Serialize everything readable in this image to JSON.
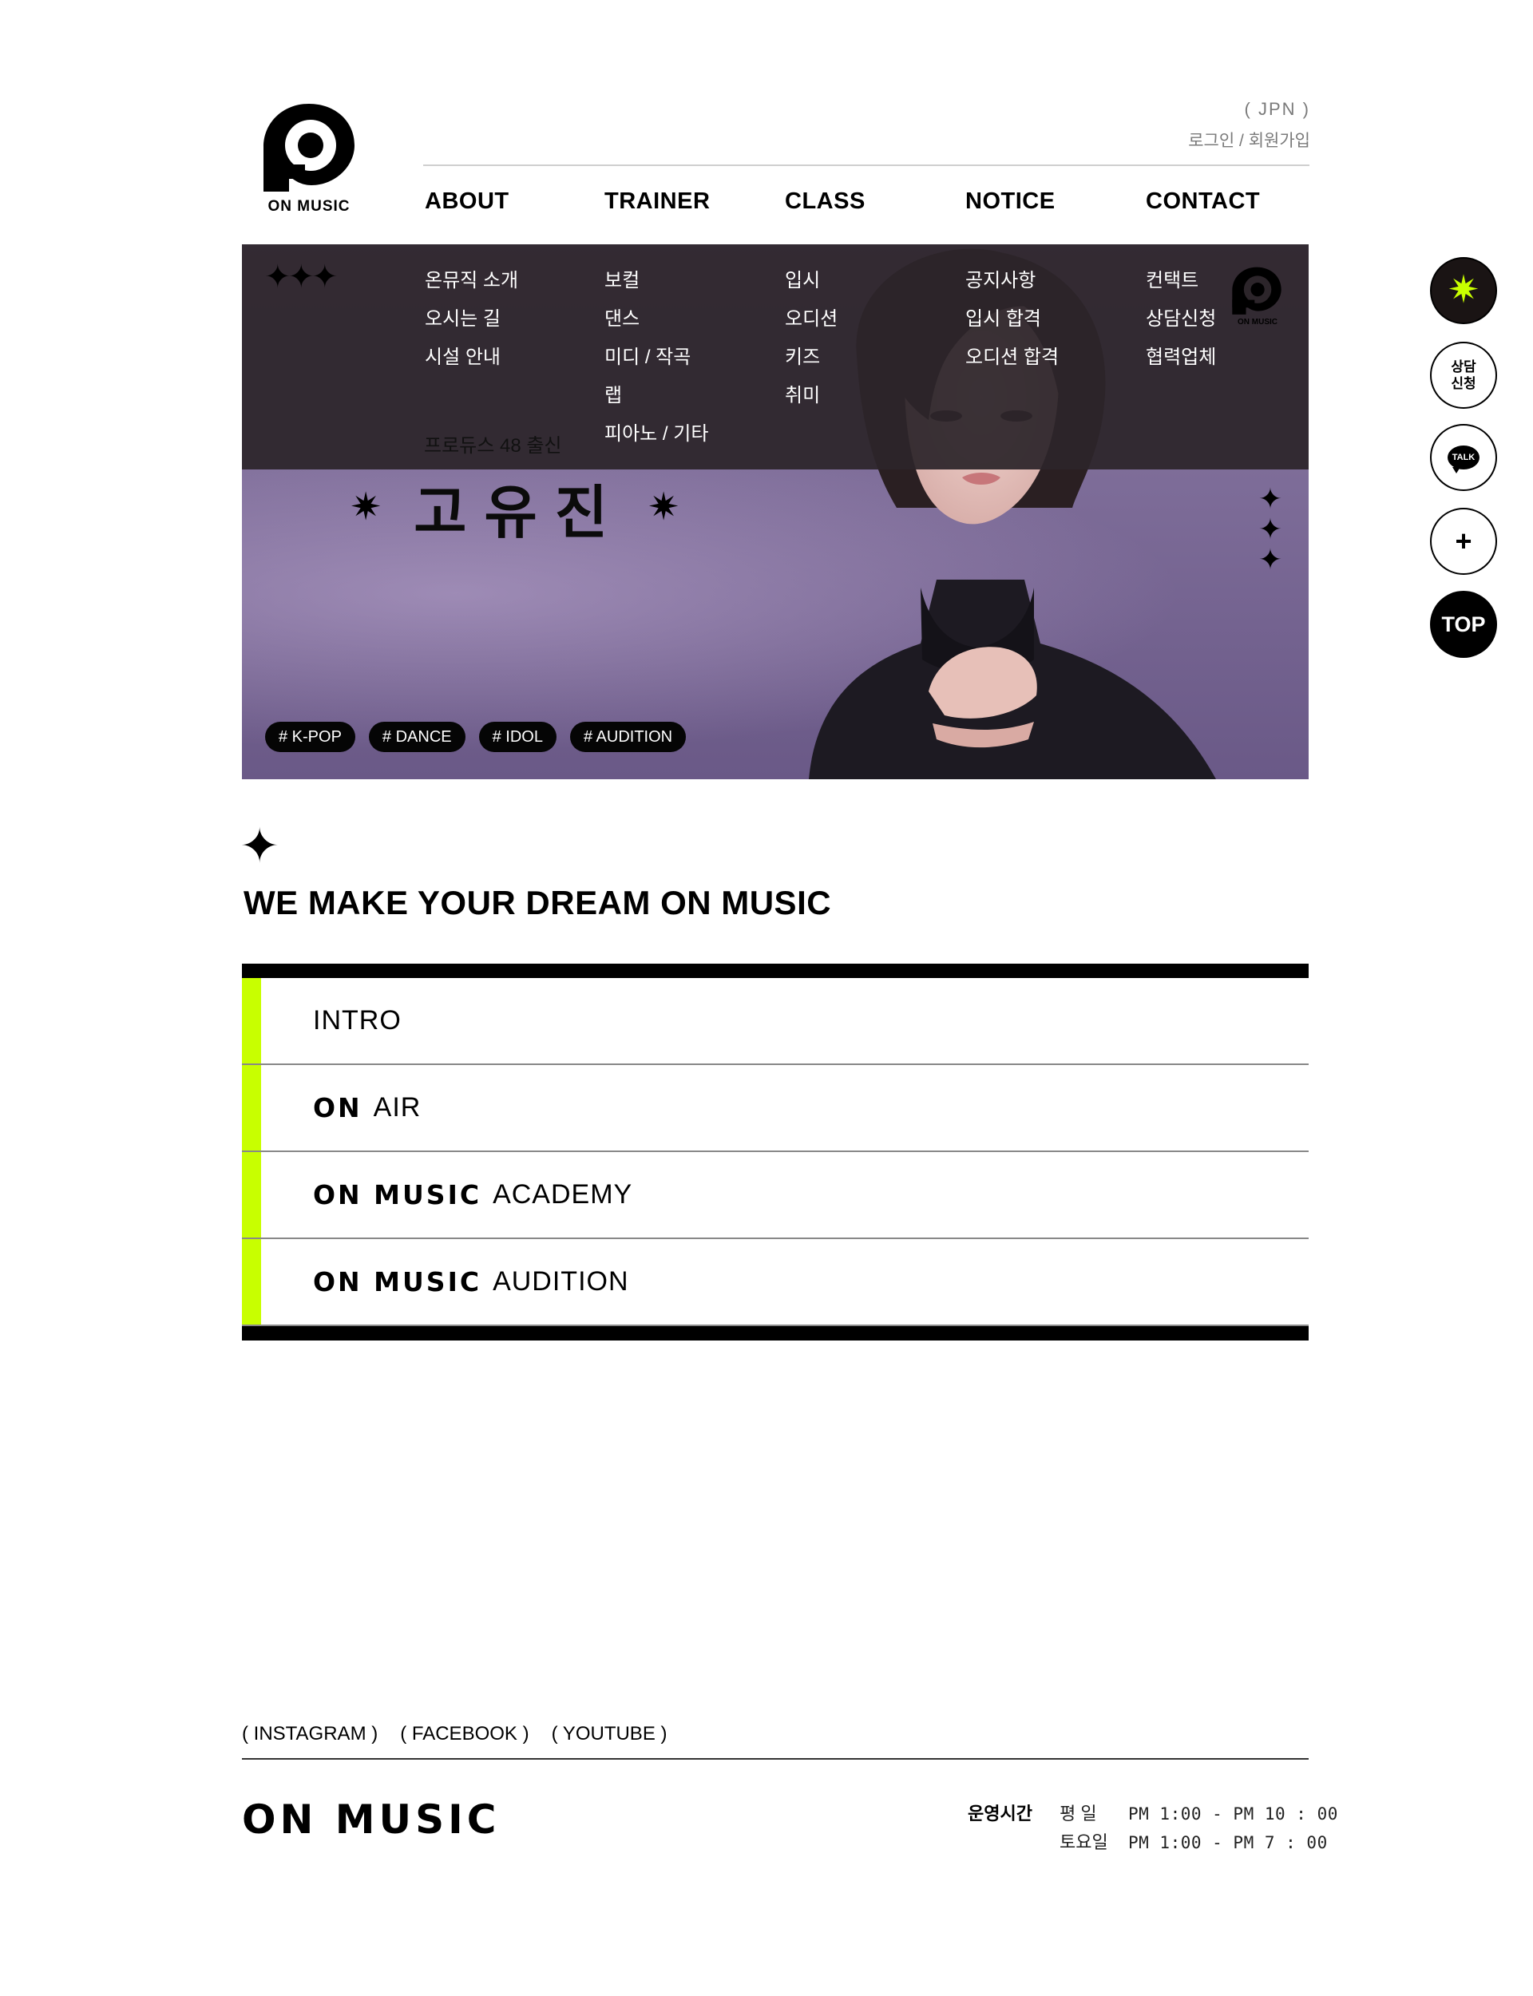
{
  "brand": {
    "logo_text": "ON MUSIC",
    "accent_color": "#c8ff00"
  },
  "header": {
    "lang": "( JPN )",
    "login": "로그인",
    "separator": " / ",
    "signup": "회원가입"
  },
  "nav": [
    {
      "label": "ABOUT",
      "menu": [
        "온뮤직 소개",
        "오시는 길",
        "시설 안내"
      ]
    },
    {
      "label": "TRAINER",
      "menu": [
        "보컬",
        "댄스",
        "미디 / 작곡",
        "랩",
        "피아노 / 기타"
      ]
    },
    {
      "label": "CLASS",
      "menu": [
        "입시",
        "오디션",
        "키즈",
        "취미"
      ]
    },
    {
      "label": "NOTICE",
      "menu": [
        "공지사항",
        "입시 합격",
        "오디션 합격"
      ]
    },
    {
      "label": "CONTACT",
      "menu": [
        "컨택트",
        "상담신청",
        "협력업체"
      ]
    }
  ],
  "hero": {
    "subtitle": "프로듀스 48 출신",
    "name": "고유진",
    "tags": [
      "# K-POP",
      "# DANCE",
      "# IDOL",
      "# AUDITION"
    ],
    "mini_logo_text": "ON MUSIC"
  },
  "slogan": "WE MAKE YOUR DREAM ON MUSIC",
  "list": [
    {
      "strong": "",
      "label": "INTRO"
    },
    {
      "strong": "ON",
      "label": "AIR"
    },
    {
      "strong": "ON MUSIC",
      "label": "ACADEMY"
    },
    {
      "strong": "ON MUSIC",
      "label": "AUDITION"
    }
  ],
  "footer": {
    "social": [
      "( INSTAGRAM )",
      "( FACEBOOK )",
      "( YOUTUBE )"
    ],
    "logo": "ON MUSIC",
    "hours_title": "운영시간",
    "hours": [
      {
        "day": "평   일",
        "time": "PM 1:00 - PM 10 : 00"
      },
      {
        "day": "토요일",
        "time": "PM 1:00 - PM   7 : 00"
      }
    ]
  },
  "floating": {
    "consult_line1": "상담",
    "consult_line2": "신청",
    "talk": "TALK",
    "plus": "+",
    "top": "TOP"
  },
  "icons": [
    "on-music-logo-icon",
    "sparkle-icon",
    "kakao-talk-icon",
    "plus-icon"
  ]
}
